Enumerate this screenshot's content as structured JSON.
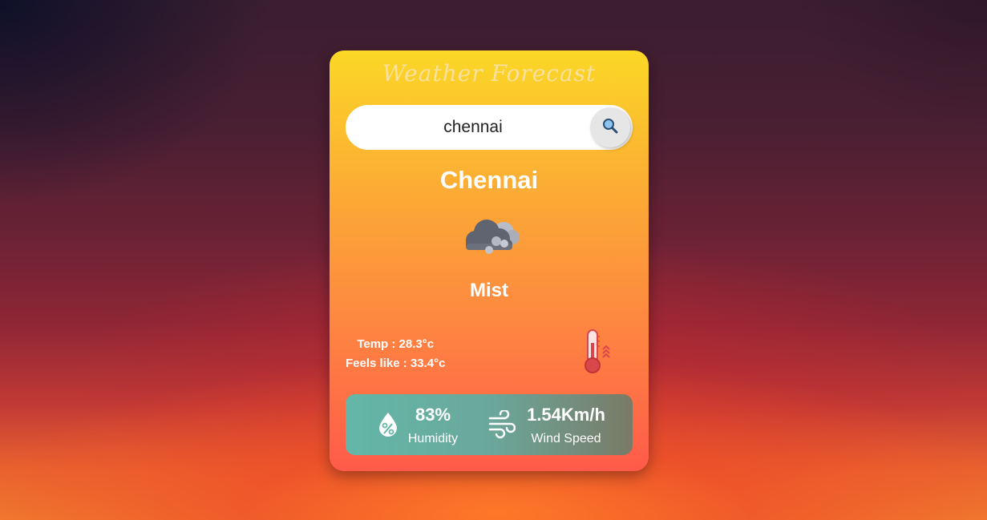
{
  "app": {
    "title": "Weather Forecast"
  },
  "search": {
    "value": "chennai",
    "button_icon": "search-icon"
  },
  "weather": {
    "city": "Chennai",
    "condition": "Mist",
    "condition_icon": "mist-cloud-icon",
    "temp_text": "Temp : 28.3°c",
    "feels_like_text": "Feels like : 33.4°c",
    "temp_icon": "thermometer-hot-icon"
  },
  "stats": {
    "humidity": {
      "value": "83%",
      "label": "Humidity",
      "icon": "humidity-icon"
    },
    "wind": {
      "value": "1.54Km/h",
      "label": "Wind Speed",
      "icon": "wind-icon"
    }
  },
  "colors": {
    "card_top": "#fbd826",
    "card_bottom": "#ff5a4a",
    "stats_panel": "#63b7a8",
    "text": "#ffffff"
  }
}
